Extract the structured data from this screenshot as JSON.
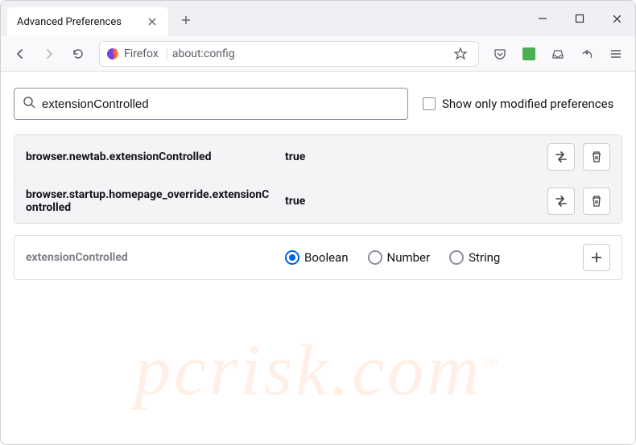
{
  "window": {
    "tab_title": "Advanced Preferences"
  },
  "toolbar": {
    "identity_label": "Firefox",
    "url": "about:config"
  },
  "search": {
    "value": "extensionControlled",
    "checkbox_label": "Show only modified preferences"
  },
  "prefs": [
    {
      "name": "browser.newtab.extensionControlled",
      "value": "true"
    },
    {
      "name": "browser.startup.homepage_override.extensionControlled",
      "value": "true"
    }
  ],
  "new_pref": {
    "name": "extensionControlled",
    "types": [
      "Boolean",
      "Number",
      "String"
    ],
    "selected": "Boolean"
  },
  "watermark": "pcrisk.com"
}
